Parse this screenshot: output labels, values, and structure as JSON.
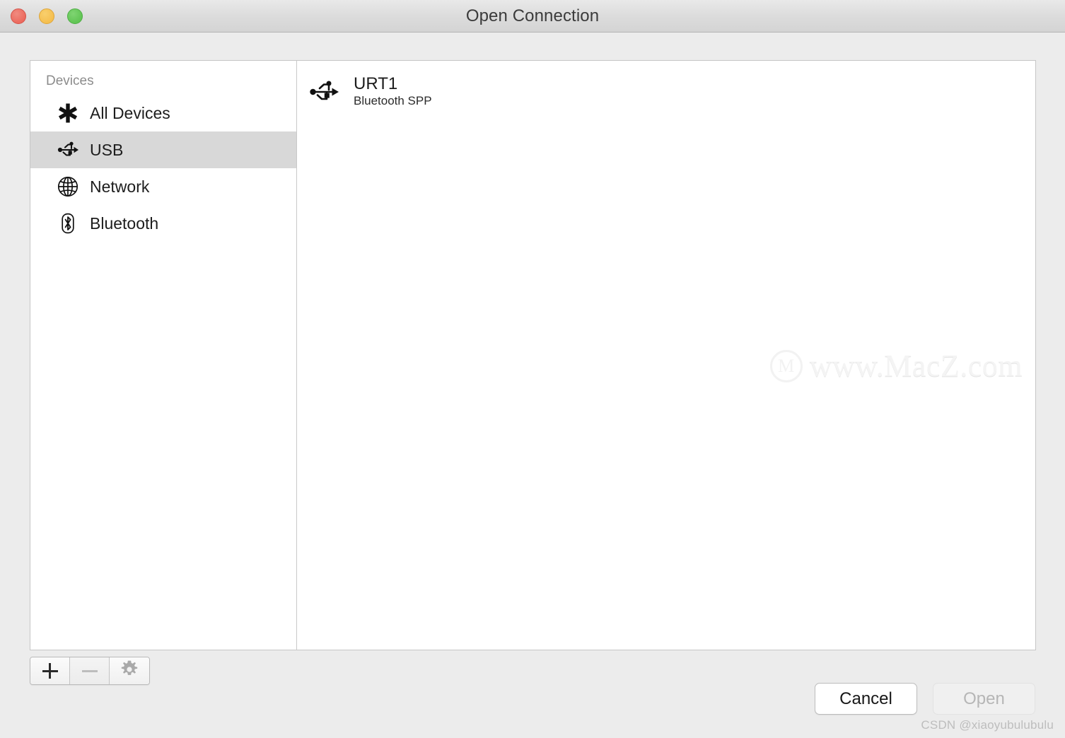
{
  "window": {
    "title": "Open Connection",
    "traffic_lights": [
      {
        "name": "close",
        "color": "#ec6a5e"
      },
      {
        "name": "minimize",
        "color": "#f5bf4f"
      },
      {
        "name": "maximize",
        "color": "#61c554"
      }
    ]
  },
  "sidebar": {
    "section_label": "Devices",
    "items": [
      {
        "label": "All Devices",
        "icon": "asterisk-icon",
        "selected": false
      },
      {
        "label": "USB",
        "icon": "usb-icon",
        "selected": true
      },
      {
        "label": "Network",
        "icon": "globe-icon",
        "selected": false
      },
      {
        "label": "Bluetooth",
        "icon": "bluetooth-icon",
        "selected": false
      }
    ]
  },
  "device_list": {
    "devices": [
      {
        "title": "URT1",
        "subtitle": "Bluetooth SPP",
        "icon": "usb-icon"
      }
    ]
  },
  "toolbar": {
    "add_label": "+",
    "remove_label": "—",
    "settings_label": "gear-icon",
    "add_enabled": true,
    "remove_enabled": false,
    "settings_enabled": true
  },
  "footer": {
    "cancel_label": "Cancel",
    "open_label": "Open",
    "open_enabled": false
  },
  "watermark": {
    "logo_letter": "M",
    "text": "www.MacZ.com"
  },
  "credit": {
    "text": "CSDN @xiaoyubulubulu"
  }
}
